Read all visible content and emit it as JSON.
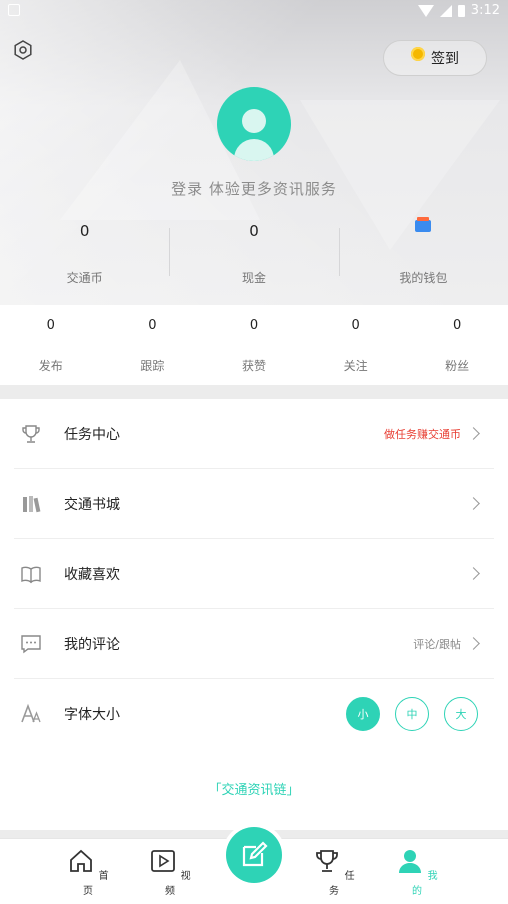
{
  "status_bar": {
    "time": "3:12"
  },
  "header": {
    "signin_label": "签到",
    "login_prompt": "登录 体验更多资讯服务",
    "stats": [
      {
        "value": "0",
        "label": "交通币"
      },
      {
        "value": "0",
        "label": "现金"
      },
      {
        "value": "",
        "label": "我的钱包"
      }
    ]
  },
  "counts": [
    {
      "value": "0",
      "label": "发布"
    },
    {
      "value": "0",
      "label": "跟踪"
    },
    {
      "value": "0",
      "label": "获赞"
    },
    {
      "value": "0",
      "label": "关注"
    },
    {
      "value": "0",
      "label": "粉丝"
    }
  ],
  "menu": {
    "items": [
      {
        "label": "任务中心",
        "right": "做任务赚交通币"
      },
      {
        "label": "交通书城",
        "right": ""
      },
      {
        "label": "收藏喜欢",
        "right": ""
      },
      {
        "label": "我的评论",
        "right": "评论/跟帖"
      },
      {
        "label": "字体大小",
        "right": ""
      }
    ],
    "font_sizes": [
      "小",
      "中",
      "大"
    ],
    "footer_link": "「交通资讯链」"
  },
  "nav": {
    "items": [
      {
        "label": "首页"
      },
      {
        "label": "视频"
      },
      {
        "label": "任务"
      },
      {
        "label": "我的"
      }
    ]
  },
  "colors": {
    "accent": "#2ed3b6",
    "alert": "#e83e33"
  }
}
